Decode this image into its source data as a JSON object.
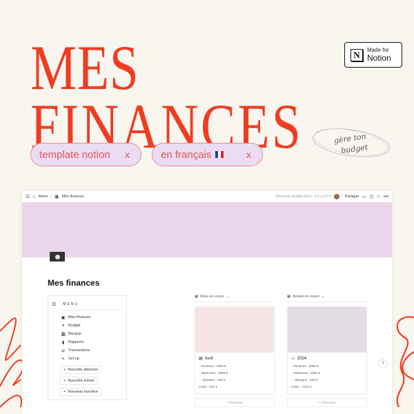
{
  "hero": {
    "title_line1": "MES",
    "title_line2": "FINANCES",
    "pills": [
      {
        "label": "template notion",
        "close": "x"
      },
      {
        "label": "en français",
        "close": "x"
      }
    ],
    "badge": {
      "small": "Made for",
      "big": "Notion",
      "logo": "N"
    },
    "stamp_line1": "gère ton",
    "stamp_line2": "budget",
    "colors": {
      "accent": "#f03c20",
      "pill_bg": "#ebdcf3",
      "cover": "#ead5ea"
    }
  },
  "topbar": {
    "workspace": "démo",
    "separator": "/",
    "page": "Mes finances",
    "last_modified": "Dernière modification : il y a 23 h",
    "share": "Partager"
  },
  "page": {
    "title": "Mes finances",
    "menu": {
      "heading": "MENU",
      "items": [
        {
          "icon": "▣",
          "label": "Mes finances"
        },
        {
          "icon": "◕",
          "label": "Budget"
        },
        {
          "icon": "🏛",
          "label": "Banque"
        },
        {
          "icon": "▮",
          "label": "Rapports"
        },
        {
          "icon": "⇄",
          "label": "Transactions"
        },
        {
          "icon": "✎",
          "label": "Set up"
        }
      ],
      "actions": [
        {
          "icon": "+",
          "label": "Nouvelle dépense"
        },
        {
          "icon": "+",
          "label": "Nouvelle entrée"
        },
        {
          "icon": "+",
          "label": "Nouveau transfert"
        }
      ]
    },
    "galleries": [
      {
        "view": "Mois en cours",
        "card": {
          "title": "Avril",
          "cover": "#f6e3e6",
          "lines": [
            "↑ Revenus : 2053 €",
            "↓ Dépenses : 1008 €",
            "→ Épargne : 200 €"
          ],
          "solde": "Solde : 845 €"
        },
        "new": "+ Nouveau"
      },
      {
        "view": "Année en cours",
        "card": {
          "title": "2024",
          "cover": "#e4dde5",
          "lines": [
            "↑ Revenus : 6053 €",
            "↓ Dépenses : 2091 €",
            "→ Épargne : 200 €"
          ],
          "solde": "Solde : 3762 €"
        },
        "new": "+ Nouveau"
      }
    ],
    "help": "?"
  }
}
